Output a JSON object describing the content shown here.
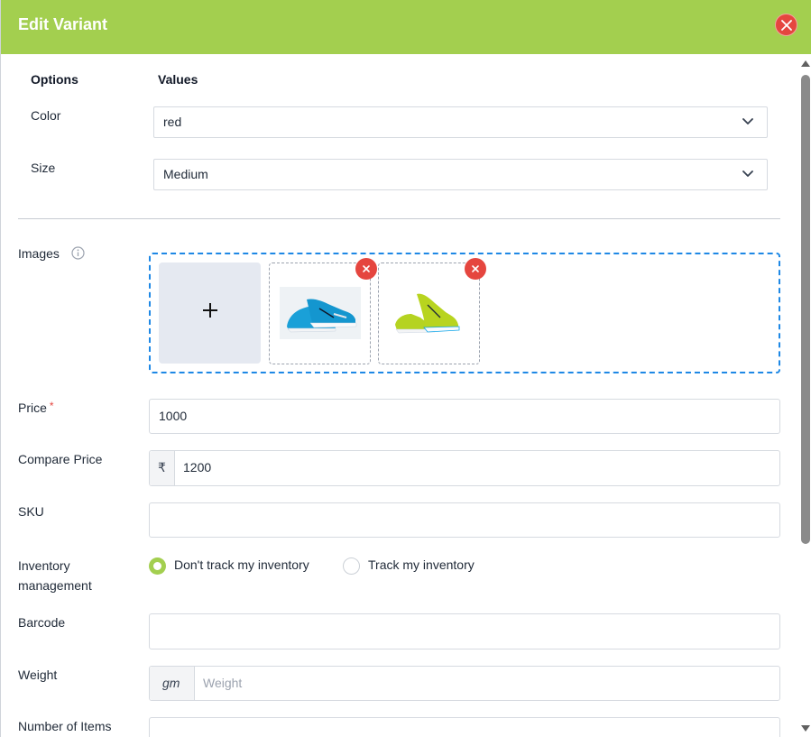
{
  "header": {
    "title": "Edit Variant"
  },
  "options_table": {
    "options_header": "Options",
    "values_header": "Values",
    "rows": [
      {
        "option": "Color",
        "value": "red"
      },
      {
        "option": "Size",
        "value": "Medium"
      }
    ]
  },
  "form": {
    "images_label": "Images",
    "price_label": "Price",
    "price_required": "*",
    "price_value": "1000",
    "compare_price_label": "Compare Price",
    "currency_symbol": "₹",
    "compare_price_value": "1200",
    "sku_label": "SKU",
    "sku_value": "",
    "inventory_label_line1": "Inventory",
    "inventory_label_line2": "management",
    "inventory_options": [
      {
        "label": "Don't track my inventory",
        "selected": true
      },
      {
        "label": "Track my inventory",
        "selected": false
      }
    ],
    "barcode_label": "Barcode",
    "barcode_value": "",
    "weight_label": "Weight",
    "weight_unit": "gm",
    "weight_placeholder": "Weight",
    "number_of_items_label": "Number of Items"
  },
  "colors": {
    "header_bg": "#a3cf4f",
    "close_red": "#e5463f",
    "dropzone_border": "#1e88e5"
  },
  "icons": [
    "close-icon",
    "chevron-down-icon",
    "info-icon",
    "plus-icon",
    "remove-icon",
    "shoe-image"
  ]
}
